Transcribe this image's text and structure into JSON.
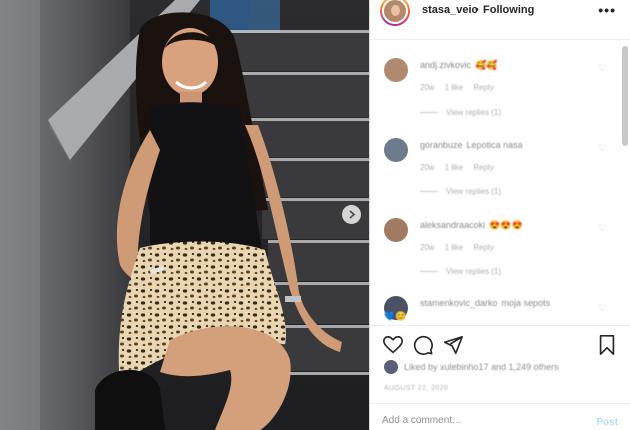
{
  "header": {
    "username": "stasa_veic",
    "separator": "•",
    "follow_status": "Following",
    "more_icon": "more-options-icon"
  },
  "photo": {
    "alt_icon": "next-photo-chevron-icon"
  },
  "comments": [
    {
      "user": "andj.zivkovic",
      "text": "🥰🥰",
      "time": "20w",
      "likes": "1 like",
      "reply": "Reply",
      "replies": "View replies (1)",
      "avatar_color": "#b08a6e"
    },
    {
      "user": "goranbuze",
      "text": "Lepotica nasa",
      "time": "20w",
      "likes": "1 like",
      "reply": "Reply",
      "replies": "View replies (1)",
      "avatar_color": "#6d7b8c"
    },
    {
      "user": "aleksandraacoki",
      "text": "😍😍😍",
      "time": "20w",
      "likes": "1 like",
      "reply": "Reply",
      "replies": "View replies (1)",
      "avatar_color": "#a07a63"
    },
    {
      "user": "stamenkovic_darko",
      "text": "moja sepots",
      "tail": "💙😊",
      "avatar_color": "#4c5266"
    }
  ],
  "actions": {
    "like_icon": "heart-outline-icon",
    "comment_icon": "comment-bubble-icon",
    "share_icon": "paper-plane-icon",
    "save_icon": "bookmark-icon"
  },
  "likes_text": "Liked by xulebinho17 and 1,249 others",
  "date": "AUGUST 22, 2020",
  "add_comment": {
    "placeholder": "Add a comment…",
    "post_label": "Post"
  },
  "colors": {
    "link_disabled": "#b2dffc",
    "text_primary": "#262626",
    "text_secondary": "#8e8e8e",
    "divider": "#efefef"
  }
}
